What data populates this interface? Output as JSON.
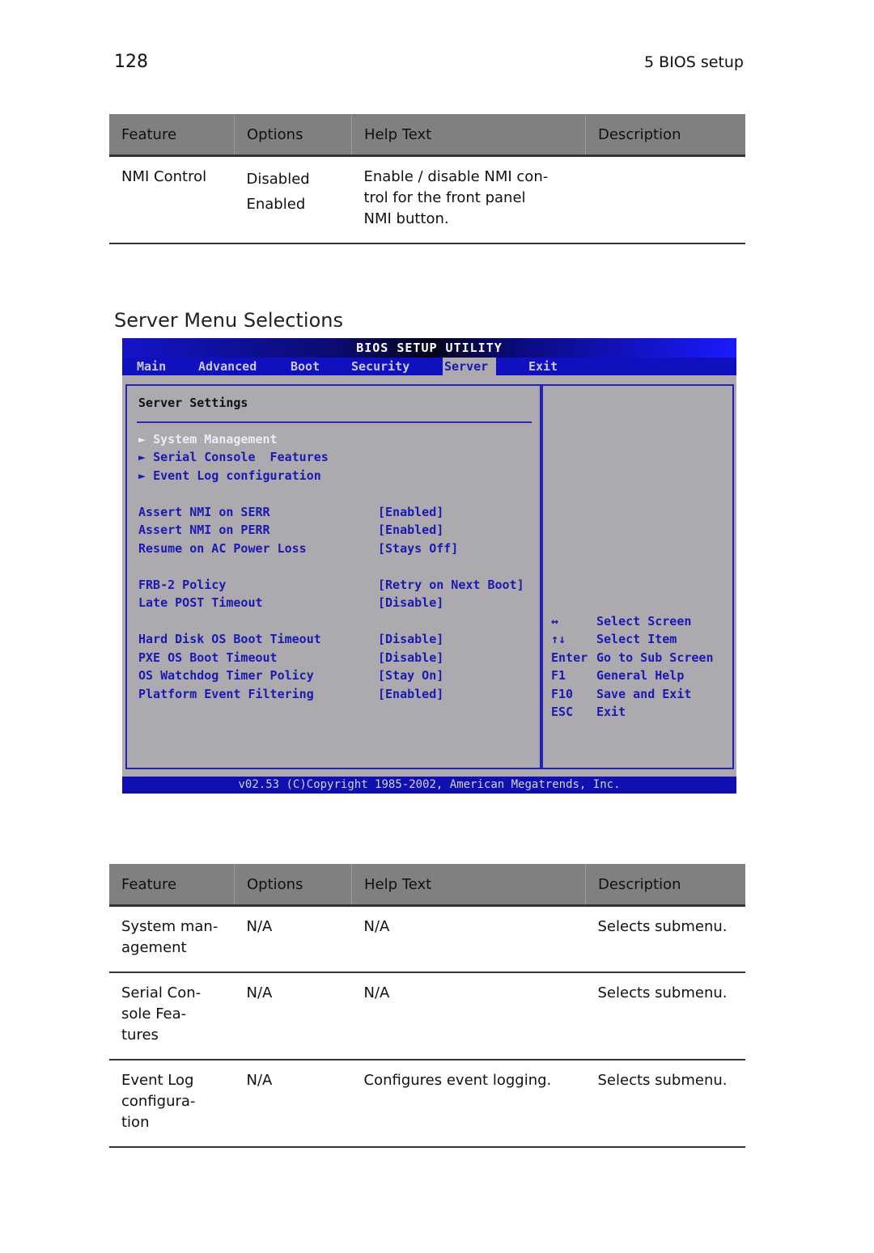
{
  "header": {
    "page_number": "128",
    "chapter": "5 BIOS setup"
  },
  "table1": {
    "columns": [
      "Feature",
      "Options",
      "Help Text",
      "Description"
    ],
    "rows": [
      {
        "feature": "NMI Control",
        "options": [
          "Disabled",
          "Enabled"
        ],
        "help": "Enable / disable NMI con- trol for the front panel NMI button.",
        "help_lines": [
          "Enable / disable NMI con-",
          "trol for the front panel",
          "NMI button."
        ],
        "description": ""
      }
    ]
  },
  "section_title": "Server Menu Selections",
  "bios": {
    "title": "BIOS SETUP UTILITY",
    "menus": [
      "Main",
      "Advanced",
      "Boot",
      "Security",
      "Server",
      "Exit"
    ],
    "active_menu": "Server",
    "heading": "Server Settings",
    "submenus": [
      {
        "label": "System Management",
        "selected": true
      },
      {
        "label": "Serial Console  Features",
        "selected": false
      },
      {
        "label": "Event Log configuration",
        "selected": false
      }
    ],
    "settings": [
      {
        "label": "Assert NMI on SERR",
        "value": "[Enabled]"
      },
      {
        "label": "Assert NMI on PERR",
        "value": "[Enabled]"
      },
      {
        "label": "Resume on AC Power Loss",
        "value": "[Stays Off]"
      },
      {
        "label": "FRB-2 Policy",
        "value": "[Retry on Next Boot]"
      },
      {
        "label": "Late POST Timeout",
        "value": "[Disable]"
      },
      {
        "label": "Hard Disk OS Boot Timeout",
        "value": "[Disable]"
      },
      {
        "label": "PXE OS Boot Timeout",
        "value": "[Disable]"
      },
      {
        "label": "OS Watchdog Timer Policy",
        "value": "[Stay On]"
      },
      {
        "label": "Platform Event Filtering",
        "value": "[Enabled]"
      }
    ],
    "keys": [
      {
        "key": "↔",
        "desc": "Select Screen"
      },
      {
        "key": "↑↓",
        "desc": "Select Item"
      },
      {
        "key": "Enter",
        "desc": "Go to Sub Screen"
      },
      {
        "key": "F1",
        "desc": "General Help"
      },
      {
        "key": "F10",
        "desc": "Save and Exit"
      },
      {
        "key": "ESC",
        "desc": "Exit"
      }
    ],
    "footer": "v02.53 (C)Copyright 1985-2002, American Megatrends, Inc."
  },
  "table2": {
    "columns": [
      "Feature",
      "Options",
      "Help Text",
      "Description"
    ],
    "rows": [
      {
        "feature_lines": [
          "System man-",
          "agement"
        ],
        "options": "N/A",
        "help": "N/A",
        "description": "Selects submenu."
      },
      {
        "feature_lines": [
          "Serial Con-",
          "sole Fea-",
          "tures"
        ],
        "options": "N/A",
        "help": "N/A",
        "description": "Selects submenu."
      },
      {
        "feature_lines": [
          "Event Log",
          "configura-",
          "tion"
        ],
        "options": "N/A",
        "help": "Configures event logging.",
        "description": "Selects submenu."
      }
    ]
  }
}
